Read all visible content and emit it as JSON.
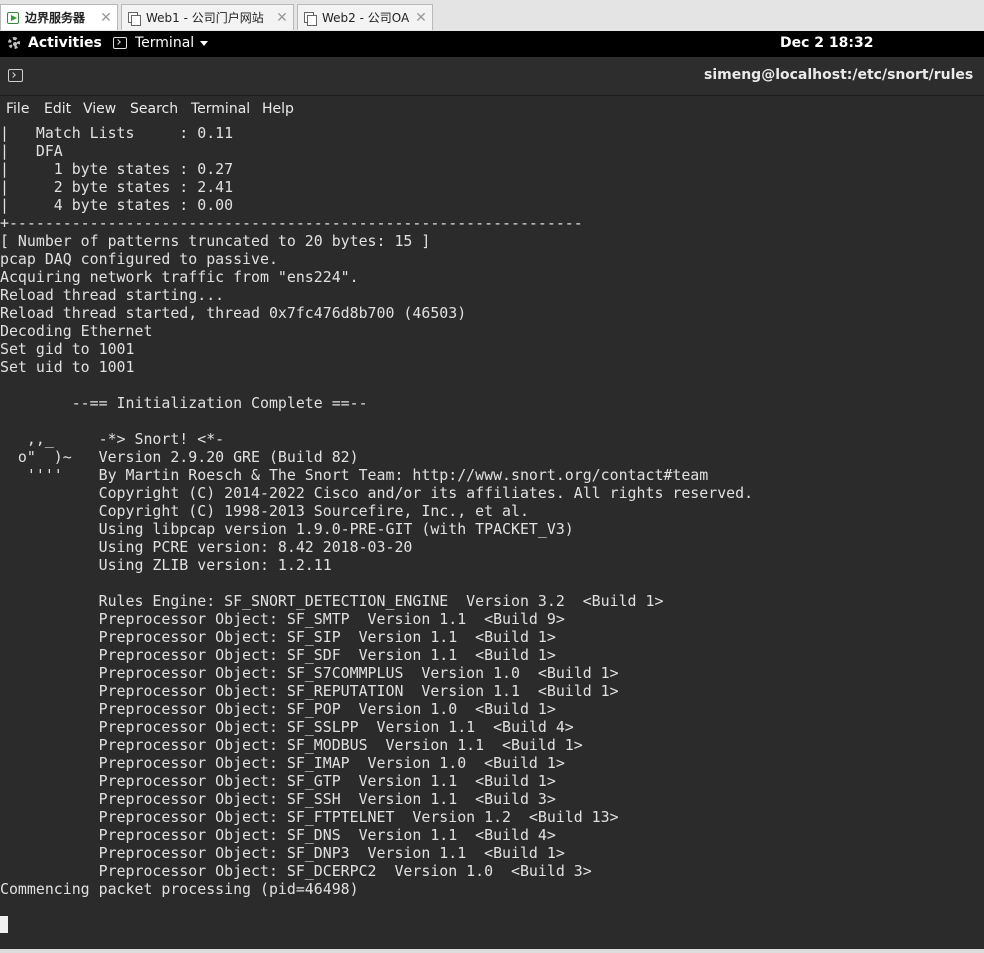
{
  "vm_tabs": [
    {
      "label": "边界服务器",
      "active": true,
      "icon": "vm-running-icon"
    },
    {
      "label": "Web1 - 公司门户网站",
      "active": false,
      "icon": "vm-icon"
    },
    {
      "label": "Web2 - 公司OA",
      "active": false,
      "icon": "vm-icon"
    }
  ],
  "topbar": {
    "activities": "Activities",
    "app_menu": "Terminal",
    "clock": "Dec 2  18:32"
  },
  "window": {
    "title": "simeng@localhost:/etc/snort/rules"
  },
  "menubar": [
    "File",
    "Edit",
    "View",
    "Search",
    "Terminal",
    "Help"
  ],
  "terminal": {
    "lines": [
      "|   Match Lists     : 0.11",
      "|   DFA",
      "|     1 byte states : 0.27",
      "|     2 byte states : 2.41",
      "|     4 byte states : 0.00",
      "+----------------------------------------------------------------",
      "[ Number of patterns truncated to 20 bytes: 15 ]",
      "pcap DAQ configured to passive.",
      "Acquiring network traffic from \"ens224\".",
      "Reload thread starting...",
      "Reload thread started, thread 0x7fc476d8b700 (46503)",
      "Decoding Ethernet",
      "Set gid to 1001",
      "Set uid to 1001",
      "",
      "        --== Initialization Complete ==--",
      "",
      "   ,,_     -*> Snort! <*-",
      "  o\"  )~   Version 2.9.20 GRE (Build 82)",
      "   ''''    By Martin Roesch & The Snort Team: http://www.snort.org/contact#team",
      "           Copyright (C) 2014-2022 Cisco and/or its affiliates. All rights reserved.",
      "           Copyright (C) 1998-2013 Sourcefire, Inc., et al.",
      "           Using libpcap version 1.9.0-PRE-GIT (with TPACKET_V3)",
      "           Using PCRE version: 8.42 2018-03-20",
      "           Using ZLIB version: 1.2.11",
      "",
      "           Rules Engine: SF_SNORT_DETECTION_ENGINE  Version 3.2  <Build 1>",
      "           Preprocessor Object: SF_SMTP  Version 1.1  <Build 9>",
      "           Preprocessor Object: SF_SIP  Version 1.1  <Build 1>",
      "           Preprocessor Object: SF_SDF  Version 1.1  <Build 1>",
      "           Preprocessor Object: SF_S7COMMPLUS  Version 1.0  <Build 1>",
      "           Preprocessor Object: SF_REPUTATION  Version 1.1  <Build 1>",
      "           Preprocessor Object: SF_POP  Version 1.0  <Build 1>",
      "           Preprocessor Object: SF_SSLPP  Version 1.1  <Build 4>",
      "           Preprocessor Object: SF_MODBUS  Version 1.1  <Build 1>",
      "           Preprocessor Object: SF_IMAP  Version 1.0  <Build 1>",
      "           Preprocessor Object: SF_GTP  Version 1.1  <Build 1>",
      "           Preprocessor Object: SF_SSH  Version 1.1  <Build 3>",
      "           Preprocessor Object: SF_FTPTELNET  Version 1.2  <Build 13>",
      "           Preprocessor Object: SF_DNS  Version 1.1  <Build 4>",
      "           Preprocessor Object: SF_DNP3  Version 1.1  <Build 1>",
      "           Preprocessor Object: SF_DCERPC2  Version 1.0  <Build 3>",
      "Commencing packet processing (pid=46498)"
    ]
  }
}
